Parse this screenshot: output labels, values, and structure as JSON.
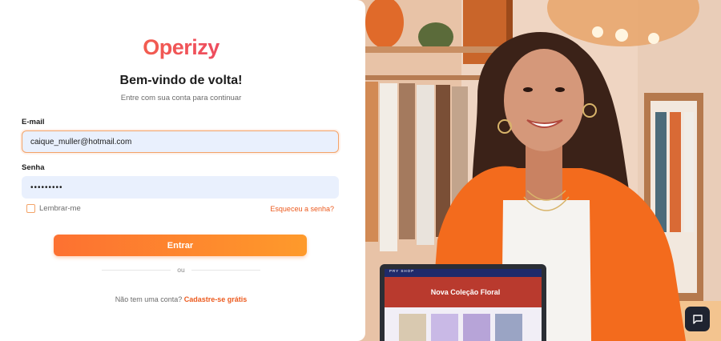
{
  "brand": {
    "logo": "Operizy",
    "accent_color": "#f97a32"
  },
  "login": {
    "title": "Bem-vindo de volta!",
    "subtitle": "Entre com sua conta para continuar",
    "email_label": "E-mail",
    "email_value": "caique_muller@hotmail.com",
    "password_label": "Senha",
    "password_value": "•••••••••",
    "remember_label": "Lembrar-me",
    "remember_checked": false,
    "forgot_link": "Esqueceu a senha?",
    "submit_label": "Entrar",
    "divider_text": "ou",
    "signup_text": "Não tem uma conta?",
    "signup_link": "Cadastre-se grátis"
  },
  "hero": {
    "laptop_banner": "Nova Coleção Floral",
    "laptop_brand": "PRY SHOP",
    "chat_icon": "chat-bubble-icon"
  }
}
